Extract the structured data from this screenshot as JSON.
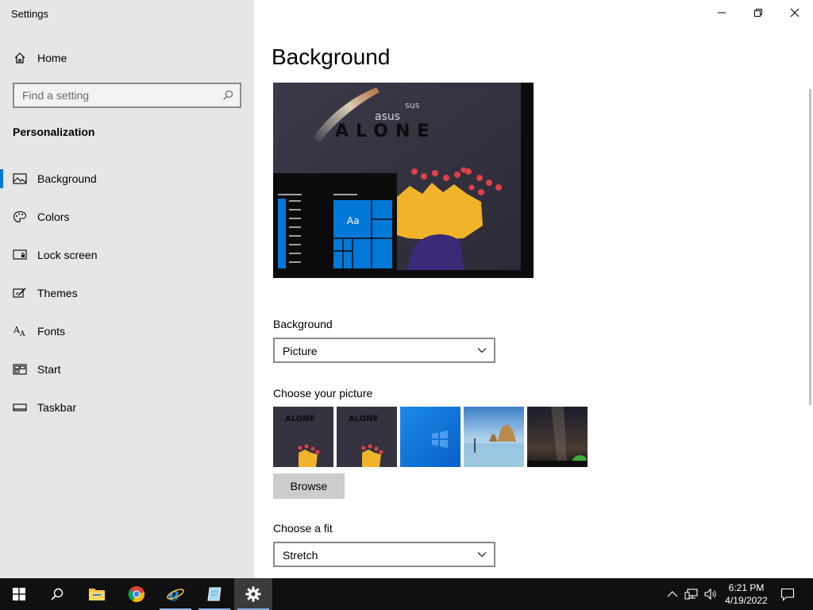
{
  "app": {
    "title": "Settings"
  },
  "sidebar": {
    "home_label": "Home",
    "search_placeholder": "Find a setting",
    "section_title": "Personalization",
    "items": [
      {
        "label": "Background",
        "icon": "picture-icon",
        "active": true
      },
      {
        "label": "Colors",
        "icon": "palette-icon",
        "active": false
      },
      {
        "label": "Lock screen",
        "icon": "lock-screen-icon",
        "active": false
      },
      {
        "label": "Themes",
        "icon": "themes-icon",
        "active": false
      },
      {
        "label": "Fonts",
        "icon": "fonts-icon",
        "active": false
      },
      {
        "label": "Start",
        "icon": "start-icon",
        "active": false
      },
      {
        "label": "Taskbar",
        "icon": "taskbar-icon",
        "active": false
      }
    ]
  },
  "main": {
    "page_title": "Background",
    "preview": {
      "text_small": "sus",
      "text_medium": "asus",
      "text_large": "ALONE",
      "tile_label": "Aa"
    },
    "background_label": "Background",
    "background_value": "Picture",
    "choose_picture_label": "Choose your picture",
    "thumbnails": [
      {
        "name": "alone-wallpaper-1",
        "caption": "ALONE"
      },
      {
        "name": "alone-wallpaper-2",
        "caption": "ALONE"
      },
      {
        "name": "windows-blue-wallpaper",
        "caption": ""
      },
      {
        "name": "beach-wallpaper",
        "caption": ""
      },
      {
        "name": "night-sky-wallpaper",
        "caption": ""
      }
    ],
    "browse_label": "Browse",
    "fit_label": "Choose a fit",
    "fit_value": "Stretch"
  },
  "taskbar": {
    "apps": [
      "start",
      "search",
      "file-explorer",
      "chrome",
      "internet-explorer",
      "notepad",
      "settings"
    ],
    "time": "6:21 PM",
    "date": "4/19/2022"
  },
  "colors": {
    "accent": "#0078d7",
    "sidebar_bg": "#e6e6e6",
    "taskbar_bg": "#101010"
  }
}
